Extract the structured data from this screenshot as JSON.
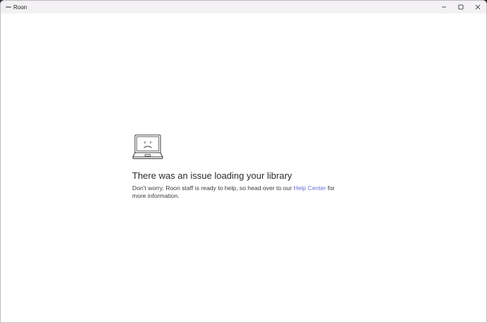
{
  "window": {
    "title": "Roon",
    "app_icon": "roon-logo-icon",
    "controls": [
      "minimize-icon",
      "maximize-icon",
      "close-icon"
    ]
  },
  "error": {
    "icon": "sad-laptop-icon",
    "heading": "There was an issue loading your library",
    "message_before": "Don't worry. Roon staff is ready to help, so head over to our ",
    "link_text": "Help Center",
    "message_after": " for more information."
  },
  "colors": {
    "link": "#6a6fd6",
    "titlebar": "#f3f1f4",
    "background": "#ffffff"
  }
}
